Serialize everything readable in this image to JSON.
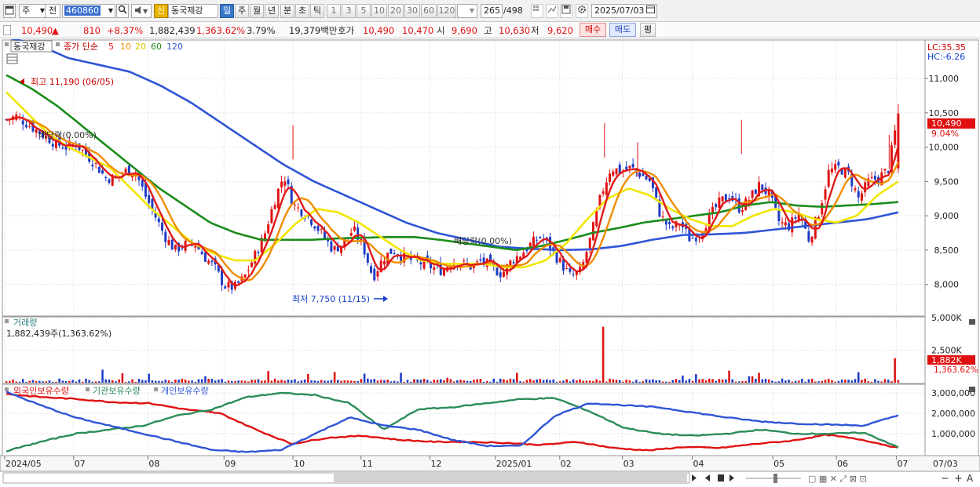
{
  "toolbar": {
    "period_type": "주",
    "range_label": "전",
    "stock_code": "460860",
    "new_badge": "신",
    "stock_name": "동국제강",
    "periods": [
      "일",
      "주",
      "월",
      "년",
      "분",
      "초",
      "틱"
    ],
    "selected_period": "일",
    "intervals": [
      "1",
      "3",
      "5",
      "10",
      "20",
      "30",
      "60",
      "120"
    ],
    "count_current": "265",
    "count_total": "/498",
    "date": "2025/07/03"
  },
  "quote": {
    "price": "10,490",
    "change_arrow": "▲",
    "change": "810",
    "change_pct": "+8.37%",
    "volume": "1,882,439",
    "volume_ratio": "1,363.62%",
    "turnover_pct": "3.79%",
    "amount": "19,379백만",
    "bid_label": "호가",
    "bid1": "10,490",
    "bid2": "10,470",
    "open_label": "시",
    "open": "9,690",
    "high_label": "고",
    "high": "10,630",
    "low_label": "저",
    "low": "9,620",
    "buy_label": "매수",
    "sell_label": "매도",
    "eval_label": "평"
  },
  "price_panel": {
    "legend_name": "동국제강",
    "legend_ma": "종가 단순",
    "ma_periods": [
      "5",
      "10",
      "20",
      "60",
      "120"
    ],
    "lc": "LC:35.35",
    "hc": "HC:-6.26",
    "current_price": "10,490",
    "current_pct": "9.04%",
    "high_note": "최고 11,190 (06/05)",
    "low_note": "최저 7,750 (11/15)",
    "dividend_note": "배당락(0.00%)"
  },
  "volume_panel": {
    "title": "거래량",
    "value_text": "1,882,439주(1,363.62%)",
    "current_label": "1,882K",
    "current_pct": "1,363.62%"
  },
  "holdings_panel": {
    "legend": [
      "외국인보유수량",
      "기관보유수량",
      "개인보유수량"
    ]
  },
  "colors": {
    "ma5": "#e01a1a",
    "ma10": "#f08c00",
    "ma20": "#f2e600",
    "ma60": "#1a8c1a",
    "ma120": "#2e55d6",
    "up": "#e01010",
    "down": "#1d3bc4",
    "foreign": "#e01010",
    "institution": "#2c8c5a",
    "individual": "#2e55d6"
  },
  "chart_data": [
    {
      "type": "candlestick",
      "title": "동국제강",
      "y_ticks": [
        "11,000",
        "10,500",
        "10,000",
        "9,500",
        "9,000",
        "8,500",
        "8,000"
      ],
      "ylim": [
        7550,
        11550
      ],
      "x_labels": [
        "2024/05",
        "07",
        "08",
        "09",
        "10",
        "11",
        "12",
        "2025/01",
        "02",
        "03",
        "04",
        "05",
        "06",
        "07",
        "07/03"
      ],
      "close_anchors": [
        10400,
        10450,
        10350,
        10250,
        10150,
        10050,
        10000,
        10050,
        9900,
        9750,
        9550,
        9550,
        9650,
        9650,
        9300,
        9000,
        8700,
        8500,
        8580,
        8600,
        8400,
        8250,
        7980,
        7950,
        8100,
        8400,
        8700,
        9200,
        9600,
        9150,
        9050,
        8900,
        8700,
        8500,
        8600,
        8800,
        8550,
        8100,
        8380,
        8500,
        8400,
        8350,
        8300,
        8250,
        8200,
        8350,
        8300,
        8250,
        8350,
        8250,
        8150,
        8350,
        8450,
        8600,
        8700,
        8500,
        8300,
        8100,
        8200,
        8700,
        9300,
        9700,
        9650,
        9700,
        9600,
        9500,
        9000,
        8800,
        8900,
        8650,
        8750,
        9000,
        9200,
        9300,
        9100,
        9250,
        9450,
        9300,
        8900,
        8850,
        9050,
        8650,
        9050,
        9650,
        9700,
        9600,
        9250,
        9500,
        9550,
        9680,
        10490
      ],
      "ma20": [
        10800,
        10500,
        10200,
        10000,
        9850,
        9700,
        9400,
        9100,
        8850,
        8600,
        8450,
        8350,
        8350,
        8600,
        8900,
        9100,
        9050,
        8900,
        8700,
        8500,
        8350,
        8300,
        8300,
        8300,
        8250,
        8250,
        8350,
        8600,
        8950,
        9250,
        9400,
        9300,
        9100,
        8950,
        8850,
        8850,
        9000,
        9100,
        9050,
        8950,
        8900,
        9000,
        9300,
        9500
      ],
      "ma60": [
        11050,
        10850,
        10600,
        10300,
        10000,
        9700,
        9400,
        9150,
        8900,
        8750,
        8650,
        8650,
        8650,
        8670,
        8680,
        8690,
        8690,
        8650,
        8600,
        8550,
        8500,
        8560,
        8650,
        8750,
        8820,
        8900,
        8950,
        9000,
        9050,
        9150,
        9200,
        9150,
        9130,
        9150,
        9170,
        9200
      ],
      "ma120": [
        11600,
        11500,
        11300,
        11200,
        11100,
        10900,
        10650,
        10350,
        10050,
        9750,
        9500,
        9300,
        9100,
        8900,
        8750,
        8650,
        8550,
        8520,
        8500,
        8510,
        8560,
        8650,
        8720,
        8730,
        8750,
        8800,
        8850,
        8900,
        8950,
        9050
      ],
      "annotations": {
        "high": 11190,
        "low": 7750
      }
    },
    {
      "type": "bar",
      "title": "거래량",
      "y_ticks": [
        "5,000K",
        "2,500K"
      ],
      "ylim": [
        0,
        5000
      ],
      "spike_values": [
        {
          "pos": 0.67,
          "value": 4300
        },
        {
          "pos": 0.997,
          "value": 1882
        }
      ]
    },
    {
      "type": "line",
      "y_ticks": [
        "3,000,000",
        "2,000,000",
        "1,000,000"
      ],
      "ylim": [
        0,
        3200000
      ],
      "series": [
        {
          "name": "외국인보유수량",
          "values": [
            2950000,
            2800000,
            2700000,
            2550000,
            2500000,
            2200000,
            2000000,
            1200000,
            500000,
            800000,
            900000,
            700000,
            600000,
            600000,
            550000,
            450000,
            600000,
            300000,
            180000,
            350000,
            300000,
            500000,
            650000,
            950000,
            700000,
            300000
          ]
        },
        {
          "name": "기관보유수량",
          "values": [
            150000,
            600000,
            1000000,
            1200000,
            1400000,
            1900000,
            2200000,
            2800000,
            3000000,
            2900000,
            2500000,
            1200000,
            2200000,
            2300000,
            2500000,
            2700000,
            2750000,
            2100000,
            1300000,
            1000000,
            900000,
            1000000,
            1200000,
            1000000,
            1000000,
            1050000,
            350000
          ]
        },
        {
          "name": "개인보유수량",
          "values": [
            3050000,
            2400000,
            1800000,
            1400000,
            1000000,
            600000,
            200000,
            100000,
            200000,
            1000000,
            1800000,
            1400000,
            1200000,
            700000,
            400000,
            400000,
            1900000,
            2500000,
            2400000,
            2300000,
            2050000,
            1800000,
            1600000,
            1500000,
            1450000,
            1400000,
            1900000
          ]
        }
      ]
    }
  ]
}
